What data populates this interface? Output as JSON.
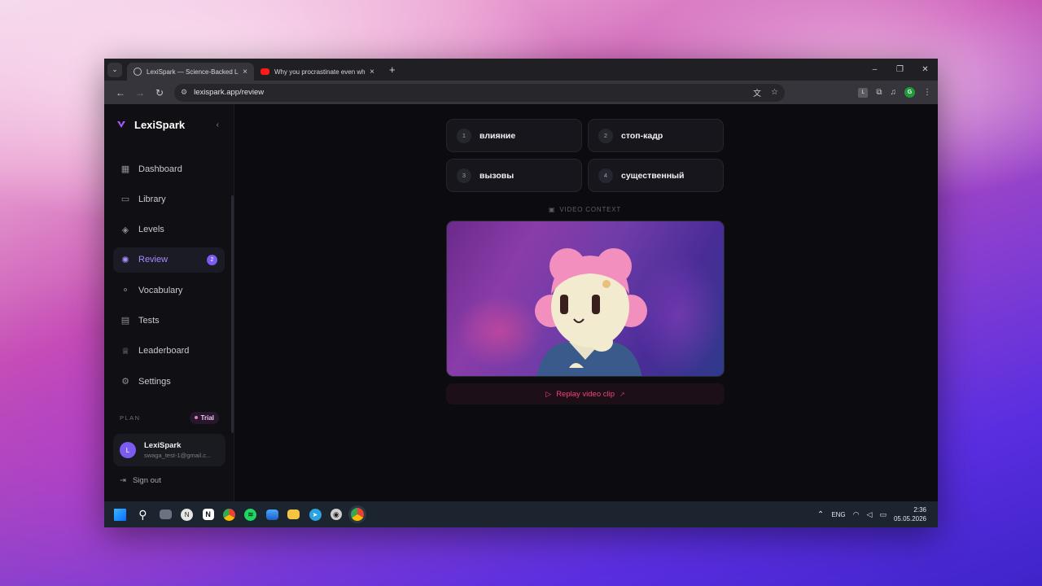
{
  "browser": {
    "tabs": [
      {
        "title": "LexiSpark — Science-Backed Lan",
        "active": true
      },
      {
        "title": "Why you procrastinate even whe",
        "active": false
      }
    ],
    "url": "lexispark.app/review",
    "new_tab": "+",
    "window_controls": {
      "minimize": "–",
      "maximize": "❐",
      "close": "✕"
    }
  },
  "sidebar": {
    "brand": "LexiSpark",
    "brand_color": "#a855f7",
    "items": [
      {
        "label": "Dashboard",
        "icon": "dashboard-icon"
      },
      {
        "label": "Library",
        "icon": "book-icon"
      },
      {
        "label": "Levels",
        "icon": "graduation-cap-icon"
      },
      {
        "label": "Review",
        "icon": "brain-icon",
        "active": true,
        "badge": "2"
      },
      {
        "label": "Vocabulary",
        "icon": "network-icon"
      },
      {
        "label": "Tests",
        "icon": "clipboard-icon"
      },
      {
        "label": "Leaderboard",
        "icon": "trophy-icon"
      },
      {
        "label": "Settings",
        "icon": "gear-icon"
      }
    ],
    "plan_label": "PLAN",
    "plan_badge": "Trial",
    "user": {
      "initial": "L",
      "name": "LexiSpark",
      "email": "swaga_test-1@gmail.c..."
    },
    "sign_out": "Sign out"
  },
  "main": {
    "answers": [
      {
        "num": "1",
        "word": "влияние"
      },
      {
        "num": "2",
        "word": "стоп-кадр"
      },
      {
        "num": "3",
        "word": "вызовы"
      },
      {
        "num": "4",
        "word": "существенный"
      }
    ],
    "video_context_label": "VIDEO CONTEXT",
    "replay_label": "Replay video clip",
    "accent": "#f0447a"
  },
  "taskbar": {
    "lang": "ENG",
    "time": "2:36",
    "date": "05.05.2026"
  }
}
